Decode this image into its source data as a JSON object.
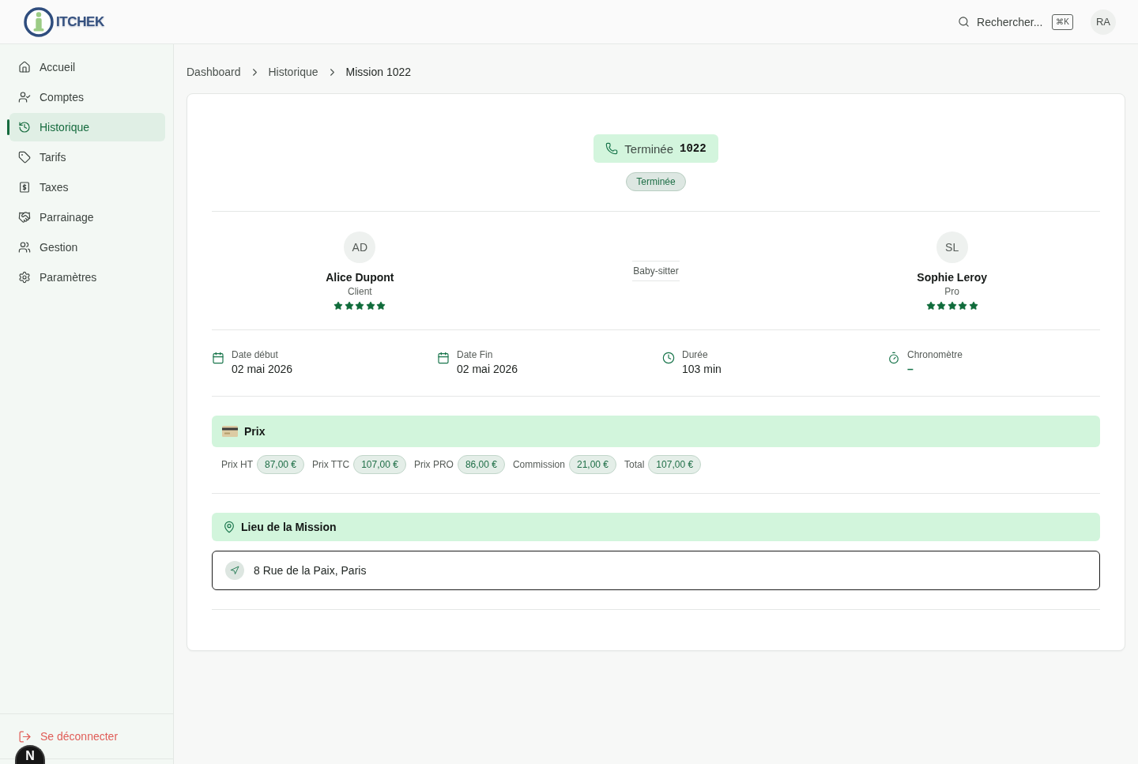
{
  "header": {
    "logo_text": "ITCHEK",
    "search": {
      "label": "Rechercher...",
      "shortcut": "⌘K"
    },
    "avatar": "RA"
  },
  "sidebar": {
    "items": [
      {
        "label": "Accueil",
        "selected": false
      },
      {
        "label": "Comptes",
        "selected": false
      },
      {
        "label": "Historique",
        "selected": true
      },
      {
        "label": "Tarifs",
        "selected": false
      },
      {
        "label": "Taxes",
        "selected": false
      },
      {
        "label": "Parrainage",
        "selected": false
      },
      {
        "label": "Gestion",
        "selected": false
      },
      {
        "label": "Paramètres",
        "selected": false
      }
    ],
    "logout": "Se déconnecter"
  },
  "dev_badge": "N",
  "breadcrumb": [
    "Dashboard",
    "Historique",
    "Mission 1022"
  ],
  "mission": {
    "status_chip": {
      "label": "Terminée",
      "number": "1022"
    },
    "status_badge": "Terminée",
    "participants": [
      {
        "initials": "AD",
        "name": "Alice Dupont",
        "role": "Client",
        "stars": 5
      },
      {
        "initials": "SL",
        "name": "Sophie Leroy",
        "role": "Pro",
        "stars": 5
      }
    ],
    "service": "Baby-sitter",
    "details": [
      {
        "kind": "date",
        "label": "Date début",
        "value": "02 mai 2026"
      },
      {
        "kind": "date",
        "label": "Date Fin",
        "value": "02 mai 2026"
      },
      {
        "kind": "duration",
        "label": "Durée",
        "value": "103 min"
      },
      {
        "kind": "stopwatch",
        "label": "Chronomètre",
        "value": "–"
      }
    ],
    "price": {
      "title": "Prix",
      "items": [
        {
          "label": "Prix HT",
          "value": "87,00 €"
        },
        {
          "label": "Prix TTC",
          "value": "107,00 €"
        },
        {
          "label": "Prix PRO",
          "value": "86,00 €"
        },
        {
          "label": "Commission",
          "value": "21,00 €"
        },
        {
          "label": "Total",
          "value": "107,00 €"
        }
      ]
    },
    "location": {
      "title": "Lieu de la Mission",
      "address": "8 Rue de la Paix, Paris"
    }
  }
}
